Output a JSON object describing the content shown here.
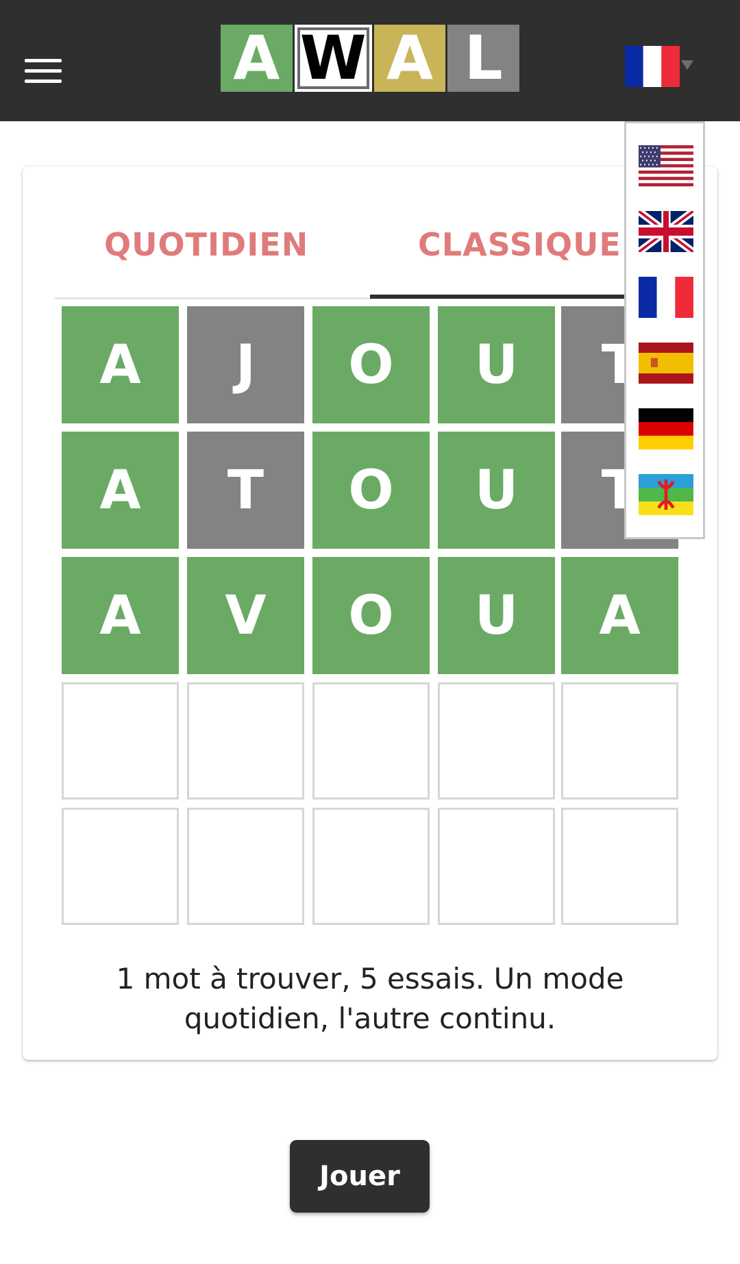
{
  "header": {
    "menu_icon": "hamburger-menu-icon",
    "logo_letters": [
      {
        "char": "A",
        "color": "#6aaa64"
      },
      {
        "char": "W",
        "color": "#ffffff"
      },
      {
        "char": "A",
        "color": "#c9b458"
      },
      {
        "char": "L",
        "color": "#838383"
      }
    ],
    "current_language_flag": "france-flag-icon"
  },
  "tabs": [
    {
      "label": "QUOTIDIEN",
      "active": false
    },
    {
      "label": "CLASSIQUE",
      "active": true
    }
  ],
  "board": {
    "rows": [
      {
        "letters": [
          "A",
          "J",
          "O",
          "U",
          "T"
        ],
        "states": [
          "correct",
          "absent",
          "correct",
          "correct",
          "absent"
        ]
      },
      {
        "letters": [
          "A",
          "T",
          "O",
          "U",
          "T"
        ],
        "states": [
          "correct",
          "absent",
          "correct",
          "correct",
          "absent"
        ]
      },
      {
        "letters": [
          "A",
          "V",
          "O",
          "U",
          "A"
        ],
        "states": [
          "correct",
          "correct",
          "correct",
          "correct",
          "correct"
        ]
      },
      {
        "letters": [
          "",
          "",
          "",
          "",
          ""
        ],
        "states": [
          "empty",
          "empty",
          "empty",
          "empty",
          "empty"
        ]
      },
      {
        "letters": [
          "",
          "",
          "",
          "",
          ""
        ],
        "states": [
          "empty",
          "empty",
          "empty",
          "empty",
          "empty"
        ]
      }
    ],
    "colors": {
      "correct": "#6aaa64",
      "absent": "#838383",
      "present": "#c9b458"
    }
  },
  "description": {
    "line1": "1 mot à trouver, 5 essais. Un mode",
    "line2": "quotidien, l'autre continu."
  },
  "play_button": {
    "label": "Jouer"
  },
  "language_menu": [
    "usa-flag-icon",
    "uk-flag-icon",
    "france-flag-icon",
    "spain-flag-icon",
    "germany-flag-icon",
    "amazigh-flag-icon"
  ]
}
